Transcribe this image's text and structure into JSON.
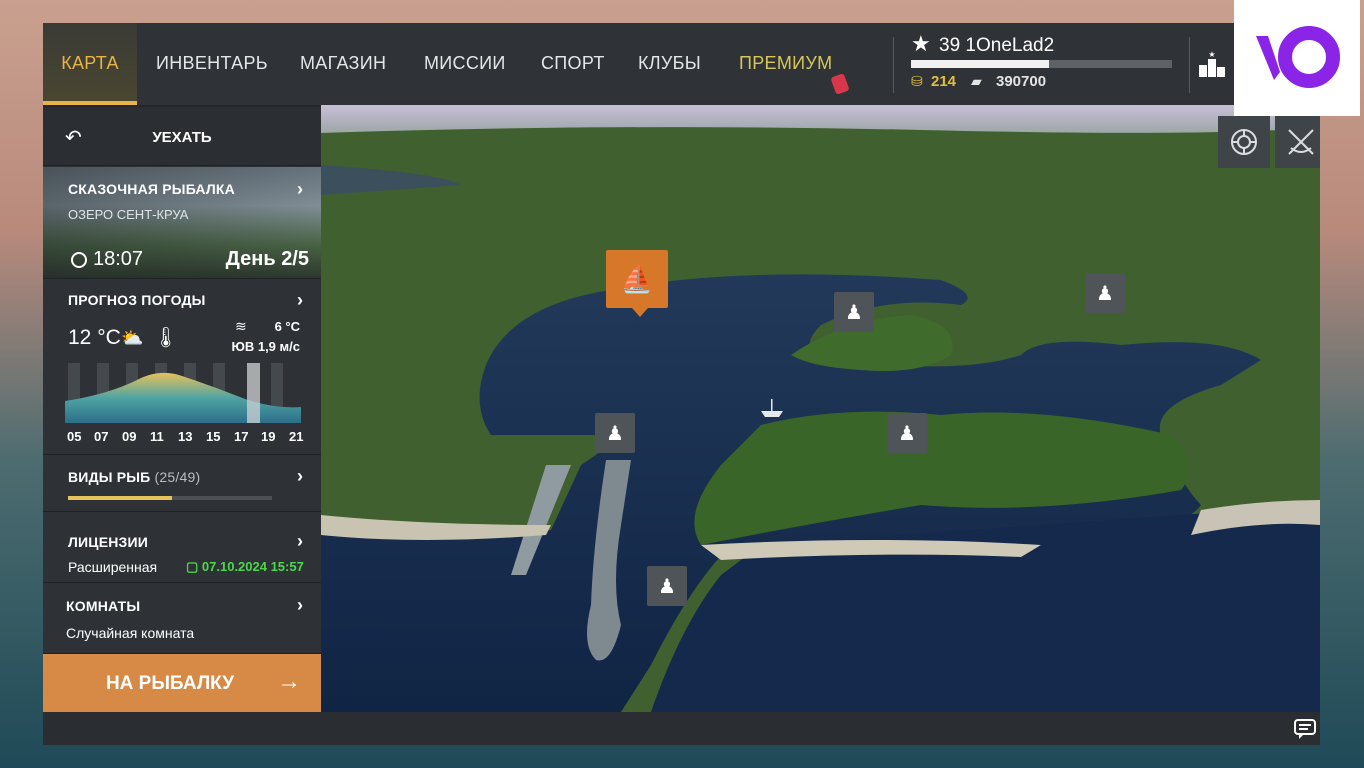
{
  "tabs": [
    {
      "label": "КАРТА",
      "active": true
    },
    {
      "label": "ИНВЕНТАРЬ"
    },
    {
      "label": "МАГАЗИН"
    },
    {
      "label": "МИССИИ"
    },
    {
      "label": "СПОРТ"
    },
    {
      "label": "КЛУБЫ"
    },
    {
      "label": "ПРЕМИУМ",
      "highlight": "#d7c75a"
    }
  ],
  "player": {
    "level_and_name": "39 1OneLad2",
    "xp_fraction": 0.53,
    "gold": "214",
    "silver": "390700"
  },
  "panel": {
    "back_label": "УЕХАТЬ",
    "location": {
      "title": "СКАЗОЧНАЯ РЫБАЛКА",
      "subtitle": "ОЗЕРО СЕНТ-КРУА",
      "time": "18:07",
      "day": "День 2/5"
    },
    "weather": {
      "title": "ПРОГНОЗ ПОГОДЫ",
      "air_temp": "12 °C",
      "water_temp": "6 °C",
      "wind": "ЮВ 1,9 м/с",
      "hours": [
        "05",
        "07",
        "09",
        "11",
        "13",
        "15",
        "17",
        "19",
        "21"
      ],
      "current_hour": "18"
    },
    "fish": {
      "title": "ВИДЫ РЫБ",
      "count": "(25/49)",
      "fraction": 0.51
    },
    "license": {
      "title": "ЛИЦЕНЗИИ",
      "type": "Расширенная",
      "expires": "07.10.2024 15:57"
    },
    "room": {
      "title": "КОМНАТЫ",
      "type": "Случайная комната"
    },
    "go_button": "НА РЫБАЛКУ"
  },
  "map": {
    "active_spot_icon": "boat-fishing-icon",
    "spot_icon": "angler-icon",
    "spot_count": 6,
    "tools": [
      "lifebuoy-icon",
      "crossed-rods-icon"
    ]
  },
  "overlay_logo": "YO",
  "colors": {
    "accent": "#e7b44a",
    "cta": "#d68a45",
    "license_green": "#4cd84c",
    "spot_active": "#d6772a"
  }
}
